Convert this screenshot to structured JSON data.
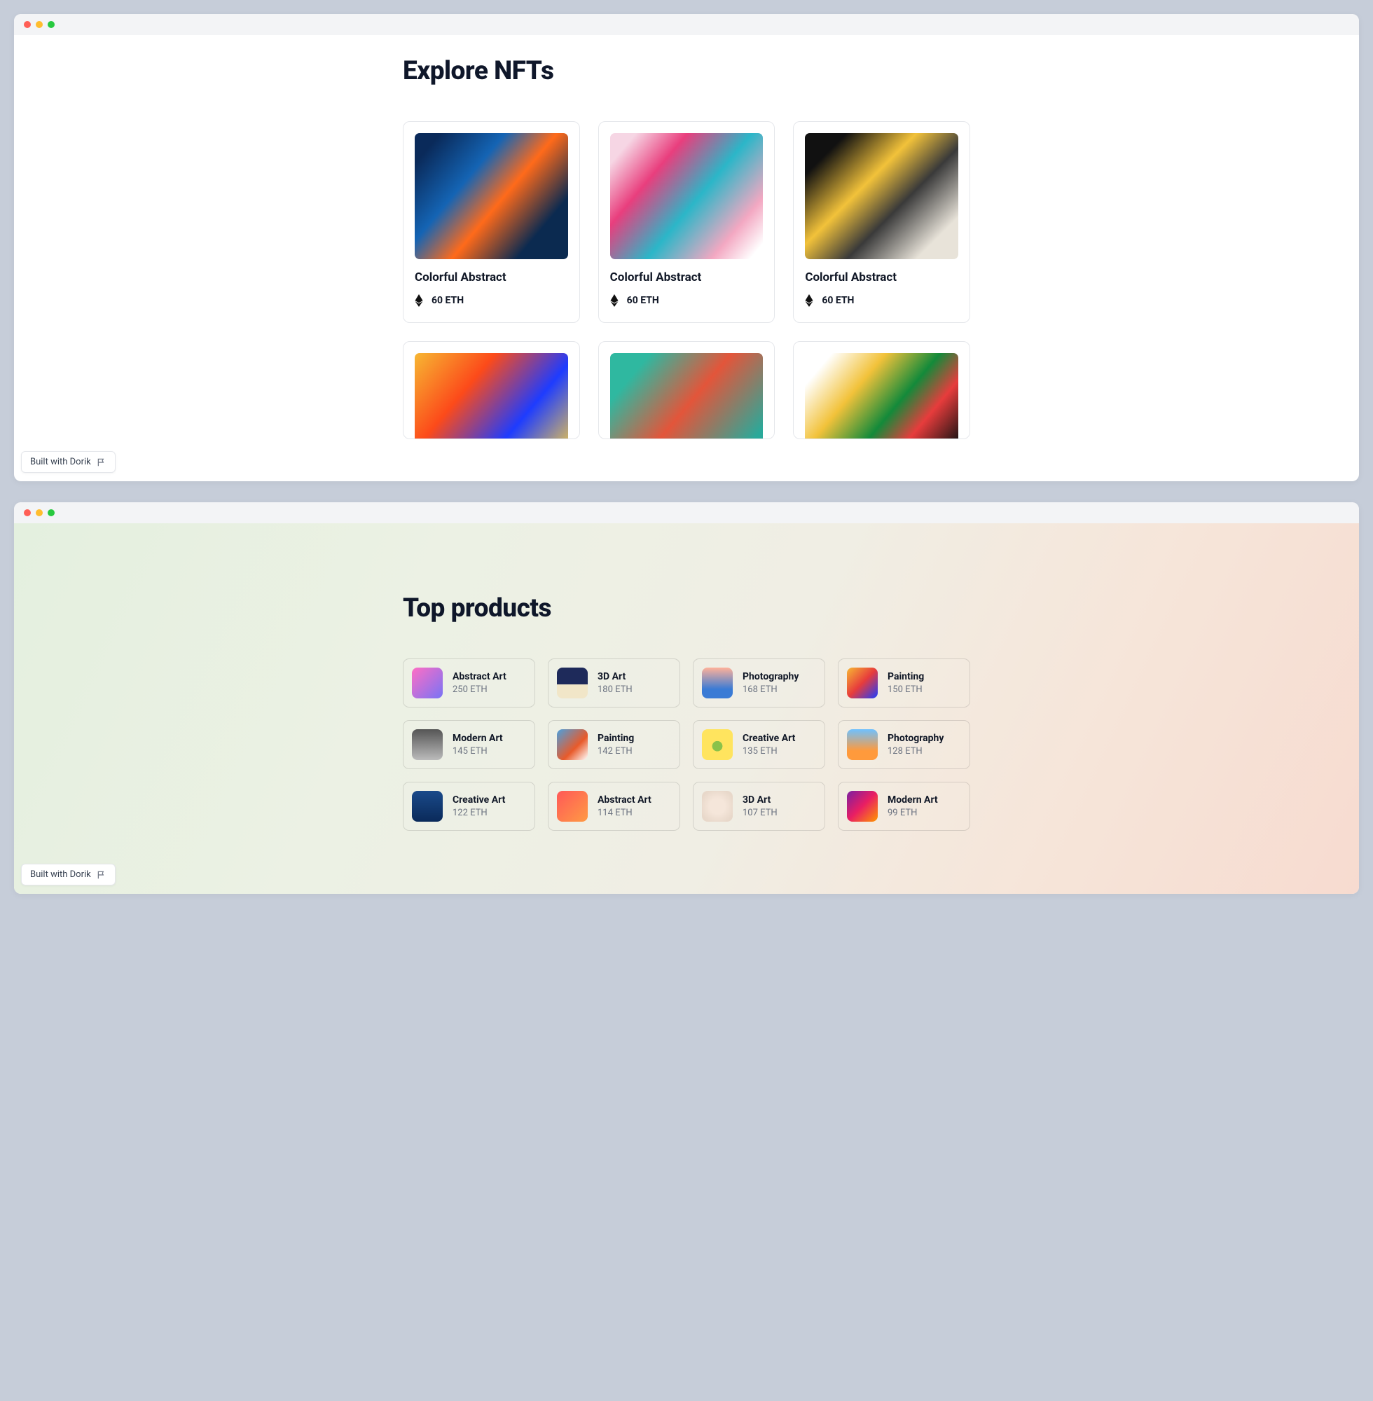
{
  "window1": {
    "title": "Explore NFTs",
    "badge": "Built with Dorik",
    "nfts": [
      {
        "title": "Colorful Abstract",
        "price": "60 ETH",
        "art": "art1"
      },
      {
        "title": "Colorful Abstract",
        "price": "60 ETH",
        "art": "art2"
      },
      {
        "title": "Colorful Abstract",
        "price": "60 ETH",
        "art": "art3"
      },
      {
        "title": "",
        "price": "",
        "art": "art4"
      },
      {
        "title": "",
        "price": "",
        "art": "art5"
      },
      {
        "title": "",
        "price": "",
        "art": "art6"
      }
    ]
  },
  "window2": {
    "title": "Top products",
    "badge": "Built with Dorik",
    "products": [
      {
        "title": "Abstract Art",
        "price": "250 ETH",
        "thumb": "t1"
      },
      {
        "title": "3D Art",
        "price": "180 ETH",
        "thumb": "t2"
      },
      {
        "title": "Photography",
        "price": "168 ETH",
        "thumb": "t3"
      },
      {
        "title": "Painting",
        "price": "150 ETH",
        "thumb": "t4"
      },
      {
        "title": "Modern Art",
        "price": "145 ETH",
        "thumb": "t5"
      },
      {
        "title": "Painting",
        "price": "142 ETH",
        "thumb": "t6"
      },
      {
        "title": "Creative Art",
        "price": "135 ETH",
        "thumb": "t7"
      },
      {
        "title": "Photography",
        "price": "128 ETH",
        "thumb": "t8"
      },
      {
        "title": "Creative Art",
        "price": "122 ETH",
        "thumb": "t9"
      },
      {
        "title": "Abstract Art",
        "price": "114 ETH",
        "thumb": "t10"
      },
      {
        "title": "3D Art",
        "price": "107 ETH",
        "thumb": "t11"
      },
      {
        "title": "Modern Art",
        "price": "99 ETH",
        "thumb": "t12"
      }
    ]
  }
}
